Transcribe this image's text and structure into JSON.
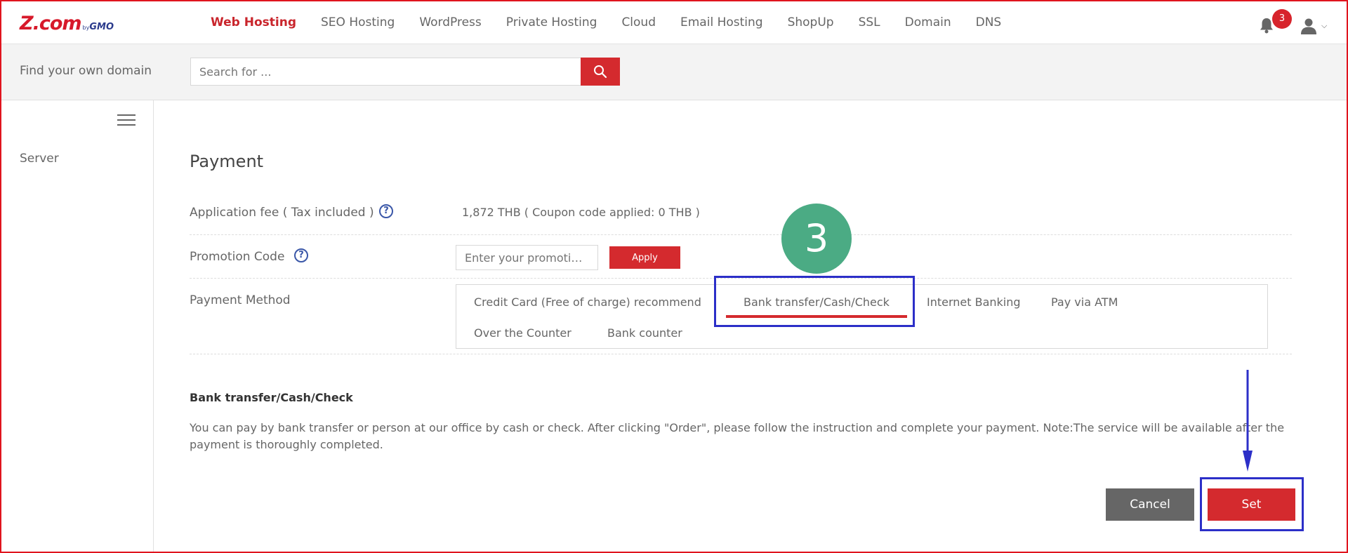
{
  "brand": {
    "logo_main": "Z.com",
    "logo_by": "by",
    "logo_gmo": "GMO",
    "accent": "#d42a2e",
    "annotation_color": "#2c2fc8",
    "step_color": "#4bab84"
  },
  "nav": {
    "items": [
      {
        "label": "Web Hosting",
        "active": true
      },
      {
        "label": "SEO Hosting"
      },
      {
        "label": "WordPress"
      },
      {
        "label": "Private Hosting"
      },
      {
        "label": "Cloud"
      },
      {
        "label": "Email Hosting"
      },
      {
        "label": "ShopUp"
      },
      {
        "label": "SSL"
      },
      {
        "label": "Domain"
      },
      {
        "label": "DNS"
      }
    ],
    "notification_count": "3",
    "icons": [
      "bell-icon",
      "user-icon",
      "chevron-down-icon"
    ]
  },
  "search": {
    "label": "Find your own domain",
    "placeholder": "Search for ...",
    "icon": "search-icon"
  },
  "sidebar": {
    "items": [
      {
        "label": "Server"
      }
    ],
    "icon": "hamburger-menu-icon"
  },
  "payment": {
    "title": "Payment",
    "fee_label": "Application fee ( Tax included )",
    "fee_value": "1,872 THB ( Coupon code applied:   0 THB )",
    "promo_label": "Promotion Code",
    "promo_placeholder": "Enter your promoti…",
    "apply_label": "Apply",
    "method_label": "Payment Method",
    "methods": [
      {
        "label": "Credit Card (Free of charge) recommend"
      },
      {
        "label": "Bank transfer/Cash/Check",
        "selected": true
      },
      {
        "label": "Internet Banking"
      },
      {
        "label": "Pay via ATM"
      },
      {
        "label": "Over the Counter"
      },
      {
        "label": "Bank counter"
      }
    ],
    "info_title": "Bank transfer/Cash/Check",
    "info_text": "You can pay by bank transfer or person at our office by cash or check. After clicking \"Order\", please follow the instruction and complete your payment. Note:The service will be available after the payment is thoroughly completed.",
    "cancel_label": "Cancel",
    "set_label": "Set"
  },
  "annotation": {
    "step_number": "3"
  }
}
